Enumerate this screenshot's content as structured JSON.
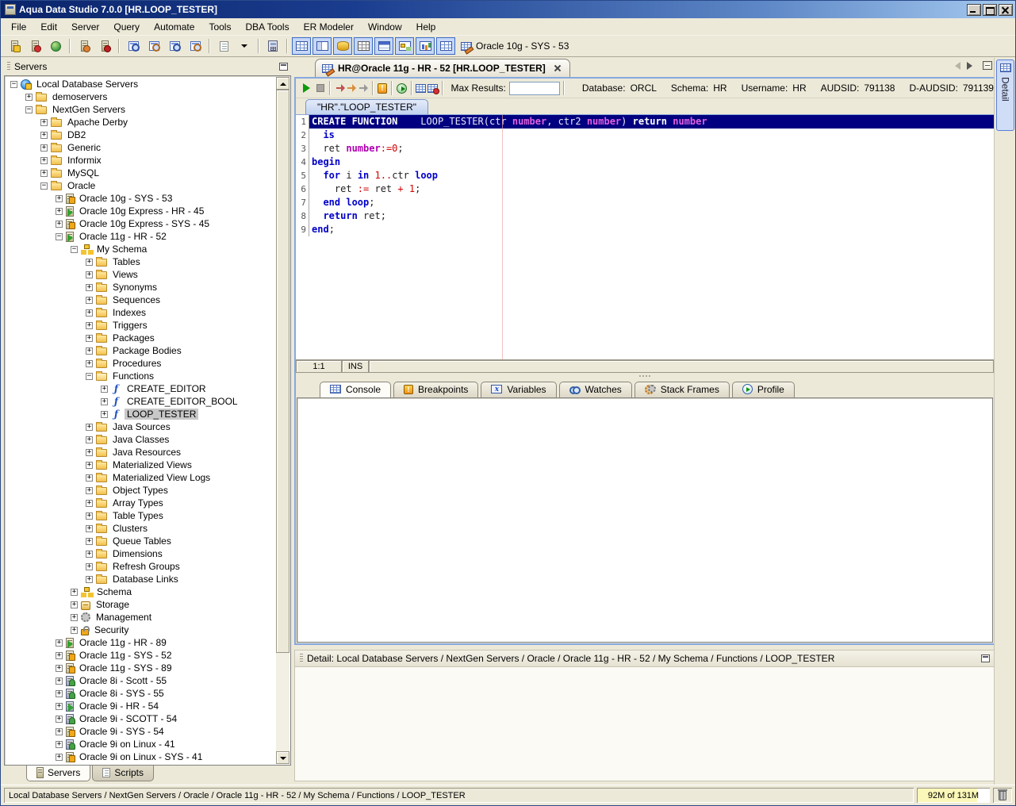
{
  "window": {
    "title": "Aqua Data Studio 7.0.0 [HR.LOOP_TESTER]",
    "controls": [
      "minimize",
      "maximize",
      "close"
    ]
  },
  "menu": {
    "items": [
      "File",
      "Edit",
      "Server",
      "Query",
      "Automate",
      "Tools",
      "DBA Tools",
      "ER Modeler",
      "Window",
      "Help"
    ]
  },
  "toolbar": {
    "buttons": [
      {
        "name": "register-server",
        "icon": "server-plus-icon",
        "cls": "mi mi-srv b-plus"
      },
      {
        "name": "unregister-server",
        "icon": "server-minus-icon",
        "cls": "mi mi-srv b-minus"
      },
      {
        "name": "connect-all",
        "icon": "globe-icon",
        "cls": "mi mi-globe"
      },
      {
        "sep": true
      },
      {
        "name": "connect-server",
        "icon": "server-connect-icon",
        "cls": "mi mi-srv b-gear"
      },
      {
        "name": "disconnect-server",
        "icon": "server-disconnect-icon",
        "cls": "mi mi-srv b-stop"
      },
      {
        "sep": true
      },
      {
        "name": "query-analyzer",
        "icon": "query-window-icon",
        "cls": "mi mi-qwin"
      },
      {
        "name": "query-analyzer-results",
        "icon": "query-window-icon",
        "cls": "mi mi-qwin alt"
      },
      {
        "name": "query-analyzer-text",
        "icon": "query-window-icon",
        "cls": "mi mi-qwin"
      },
      {
        "name": "query-builder",
        "icon": "query-builder-icon",
        "cls": "mi mi-qwin alt"
      },
      {
        "sep": true
      },
      {
        "name": "open-script",
        "icon": "script-icon",
        "cls": "mi mi-script"
      },
      {
        "name": "script-dropdown",
        "icon": "dropdown-arrow-icon",
        "cls": "mi mi-dd"
      },
      {
        "sep": true
      },
      {
        "name": "tools-window",
        "icon": "calculator-icon",
        "cls": "mi mi-calc"
      },
      {
        "sep": true
      },
      {
        "name": "view-grid",
        "icon": "view-grid-icon",
        "cls": "vi vi-grid",
        "pressed": true
      },
      {
        "name": "view-form",
        "icon": "view-form-icon",
        "cls": "vi vi-form",
        "pressed": true
      },
      {
        "name": "view-database",
        "icon": "view-database-icon",
        "cls": "vi vi-db",
        "pressed": true
      },
      {
        "name": "view-table",
        "icon": "view-table-icon",
        "cls": "vi vi-table",
        "pressed": true
      },
      {
        "name": "view-schedule",
        "icon": "view-schedule-icon",
        "cls": "vi vi-cal",
        "pressed": true
      },
      {
        "name": "view-references",
        "icon": "view-references-icon",
        "cls": "vi vi-rel",
        "pressed": true
      },
      {
        "name": "view-chart",
        "icon": "view-chart-icon",
        "cls": "vi vi-chart",
        "pressed": true
      },
      {
        "name": "view-detail",
        "icon": "view-detail-icon",
        "cls": "vi vi-grid2",
        "pressed": true
      }
    ],
    "connection_label": "Oracle 10g - SYS - 53"
  },
  "servers_panel": {
    "title": "Servers",
    "bottom_tabs": [
      {
        "label": "Servers",
        "icon": "server-icon",
        "active": true
      },
      {
        "label": "Scripts",
        "icon": "script-icon",
        "active": false
      }
    ],
    "tree": [
      {
        "label": "Local Database Servers",
        "level": 0,
        "exp": "-",
        "icon": "globe"
      },
      {
        "label": "demoservers",
        "level": 1,
        "exp": "+",
        "icon": "folder"
      },
      {
        "label": "NextGen Servers",
        "level": 1,
        "exp": "-",
        "icon": "folder"
      },
      {
        "label": "Apache Derby",
        "level": 2,
        "exp": "+",
        "icon": "folder"
      },
      {
        "label": "DB2",
        "level": 2,
        "exp": "+",
        "icon": "folder"
      },
      {
        "label": "Generic",
        "level": 2,
        "exp": "+",
        "icon": "folder"
      },
      {
        "label": "Informix",
        "level": 2,
        "exp": "+",
        "icon": "folder"
      },
      {
        "label": "MySQL",
        "level": 2,
        "exp": "+",
        "icon": "folder"
      },
      {
        "label": "Oracle",
        "level": 2,
        "exp": "-",
        "icon": "folder"
      },
      {
        "label": "Oracle 10g - SYS - 53",
        "level": 3,
        "exp": "+",
        "icon": "srv-sys"
      },
      {
        "label": "Oracle 10g Express - HR - 45",
        "level": 3,
        "exp": "+",
        "icon": "srv-hr"
      },
      {
        "label": "Oracle 10g Express - SYS - 45",
        "level": 3,
        "exp": "+",
        "icon": "srv-sys"
      },
      {
        "label": "Oracle 11g - HR - 52",
        "level": 3,
        "exp": "-",
        "icon": "srv-hr"
      },
      {
        "label": "My Schema",
        "level": 4,
        "exp": "-",
        "icon": "schema"
      },
      {
        "label": "Tables",
        "level": 5,
        "exp": "+",
        "icon": "folder"
      },
      {
        "label": "Views",
        "level": 5,
        "exp": "+",
        "icon": "folder"
      },
      {
        "label": "Synonyms",
        "level": 5,
        "exp": "+",
        "icon": "folder"
      },
      {
        "label": "Sequences",
        "level": 5,
        "exp": "+",
        "icon": "folder"
      },
      {
        "label": "Indexes",
        "level": 5,
        "exp": "+",
        "icon": "folder"
      },
      {
        "label": "Triggers",
        "level": 5,
        "exp": "+",
        "icon": "folder"
      },
      {
        "label": "Packages",
        "level": 5,
        "exp": "+",
        "icon": "folder"
      },
      {
        "label": "Package Bodies",
        "level": 5,
        "exp": "+",
        "icon": "folder"
      },
      {
        "label": "Procedures",
        "level": 5,
        "exp": "+",
        "icon": "folder"
      },
      {
        "label": "Functions",
        "level": 5,
        "exp": "-",
        "icon": "folder-open"
      },
      {
        "label": "CREATE_EDITOR",
        "level": 6,
        "exp": "+",
        "icon": "fn"
      },
      {
        "label": "CREATE_EDITOR_BOOL",
        "level": 6,
        "exp": "+",
        "icon": "fn"
      },
      {
        "label": "LOOP_TESTER",
        "level": 6,
        "exp": "+",
        "icon": "fn",
        "selected": true
      },
      {
        "label": "Java Sources",
        "level": 5,
        "exp": "+",
        "icon": "folder"
      },
      {
        "label": "Java Classes",
        "level": 5,
        "exp": "+",
        "icon": "folder"
      },
      {
        "label": "Java Resources",
        "level": 5,
        "exp": "+",
        "icon": "folder"
      },
      {
        "label": "Materialized Views",
        "level": 5,
        "exp": "+",
        "icon": "folder"
      },
      {
        "label": "Materialized View Logs",
        "level": 5,
        "exp": "+",
        "icon": "folder"
      },
      {
        "label": "Object Types",
        "level": 5,
        "exp": "+",
        "icon": "folder"
      },
      {
        "label": "Array Types",
        "level": 5,
        "exp": "+",
        "icon": "folder"
      },
      {
        "label": "Table Types",
        "level": 5,
        "exp": "+",
        "icon": "folder"
      },
      {
        "label": "Clusters",
        "level": 5,
        "exp": "+",
        "icon": "folder"
      },
      {
        "label": "Queue Tables",
        "level": 5,
        "exp": "+",
        "icon": "folder"
      },
      {
        "label": "Dimensions",
        "level": 5,
        "exp": "+",
        "icon": "folder"
      },
      {
        "label": "Refresh Groups",
        "level": 5,
        "exp": "+",
        "icon": "folder"
      },
      {
        "label": "Database Links",
        "level": 5,
        "exp": "+",
        "icon": "folder"
      },
      {
        "label": "Schema",
        "level": 4,
        "exp": "+",
        "icon": "schema"
      },
      {
        "label": "Storage",
        "level": 4,
        "exp": "+",
        "icon": "storage"
      },
      {
        "label": "Management",
        "level": 4,
        "exp": "+",
        "icon": "mgmt"
      },
      {
        "label": "Security",
        "level": 4,
        "exp": "+",
        "icon": "security"
      },
      {
        "label": "Oracle 11g - HR - 89",
        "level": 3,
        "exp": "+",
        "icon": "srv-hr"
      },
      {
        "label": "Oracle 11g - SYS - 52",
        "level": 3,
        "exp": "+",
        "icon": "srv-sys"
      },
      {
        "label": "Oracle 11g - SYS - 89",
        "level": 3,
        "exp": "+",
        "icon": "srv-sys"
      },
      {
        "label": "Oracle 8i - Scott - 55",
        "level": 3,
        "exp": "+",
        "icon": "srv-8"
      },
      {
        "label": "Oracle 8i - SYS - 55",
        "level": 3,
        "exp": "+",
        "icon": "srv-8"
      },
      {
        "label": "Oracle 9i - HR - 54",
        "level": 3,
        "exp": "+",
        "icon": "srv-8hr"
      },
      {
        "label": "Oracle 9i - SCOTT - 54",
        "level": 3,
        "exp": "+",
        "icon": "srv-8"
      },
      {
        "label": "Oracle 9i - SYS - 54",
        "level": 3,
        "exp": "+",
        "icon": "srv-sys"
      },
      {
        "label": "Oracle 9i on Linux - 41",
        "level": 3,
        "exp": "+",
        "icon": "srv-8"
      },
      {
        "label": "Oracle 9i on Linux - SYS - 41",
        "level": 3,
        "exp": "+",
        "icon": "srv-sys"
      },
      {
        "label": "",
        "level": 2,
        "exp": "",
        "icon": "folder"
      }
    ]
  },
  "editor": {
    "doc_tab": "HR@Oracle 11g - HR - 52 [HR.LOOP_TESTER]",
    "inner_tab": "\"HR\".\"LOOP_TESTER\"",
    "max_results_label": "Max Results:",
    "max_results_value": "",
    "info": [
      {
        "label": "Database:",
        "value": "ORCL"
      },
      {
        "label": "Schema:",
        "value": "HR"
      },
      {
        "label": "Username:",
        "value": "HR"
      },
      {
        "label": "AUDSID:",
        "value": "791138"
      },
      {
        "label": "D-AUDSID:",
        "value": "791139"
      }
    ],
    "qbuttons": [
      {
        "name": "execute",
        "icon": "play-icon",
        "cls": "ic-play"
      },
      {
        "name": "stop",
        "icon": "stop-icon",
        "cls": "ic-stop"
      },
      {
        "sep": true
      },
      {
        "name": "step-into",
        "icon": "step-into-icon",
        "cls": "ic-arr red"
      },
      {
        "name": "step-over",
        "icon": "step-over-icon",
        "cls": "ic-arr org"
      },
      {
        "name": "step-out",
        "icon": "step-out-icon",
        "cls": "ic-arr gry"
      },
      {
        "sep": true
      },
      {
        "name": "toggle-breakpoint",
        "icon": "breakpoint-icon",
        "cls": "ic-warn",
        "text": "!"
      },
      {
        "sep": true
      },
      {
        "name": "history",
        "icon": "history-clock-icon",
        "cls": "ic-clock"
      },
      {
        "sep": true
      },
      {
        "name": "results-grid",
        "icon": "results-grid-icon",
        "cls": "ic-gridx"
      },
      {
        "name": "results-options",
        "icon": "results-options-icon",
        "cls": "ic-gridx star"
      },
      {
        "sep": true
      }
    ],
    "status": {
      "cursor": "1:1",
      "mode": "INS"
    },
    "code": [
      {
        "num": "1",
        "sel": true,
        "toks": [
          [
            "CREATE FUNCTION",
            "skw"
          ],
          [
            "    LOOP_TESTER(ctr ",
            "spl"
          ],
          [
            "number",
            "sty"
          ],
          [
            ", ctr2 ",
            "spl"
          ],
          [
            "number",
            "sty"
          ],
          [
            ") ",
            "spl"
          ],
          [
            "return",
            "skw"
          ],
          [
            " ",
            "spl"
          ],
          [
            "number",
            "sty"
          ]
        ]
      },
      {
        "num": "2",
        "toks": [
          [
            "  ",
            "pl"
          ],
          [
            "is",
            "kw"
          ]
        ]
      },
      {
        "num": "3",
        "toks": [
          [
            "  ret ",
            "pl"
          ],
          [
            "number",
            "ty"
          ],
          [
            ":=",
            "op"
          ],
          [
            "0",
            "num"
          ],
          [
            ";",
            "pl"
          ]
        ]
      },
      {
        "num": "4",
        "toks": [
          [
            "begin",
            "kw"
          ]
        ]
      },
      {
        "num": "5",
        "toks": [
          [
            "  ",
            "pl"
          ],
          [
            "for",
            "kw"
          ],
          [
            " i ",
            "pl"
          ],
          [
            "in",
            "kw"
          ],
          [
            " ",
            "pl"
          ],
          [
            "1",
            "num"
          ],
          [
            "..",
            "op"
          ],
          [
            "ctr ",
            "pl"
          ],
          [
            "loop",
            "kw"
          ]
        ]
      },
      {
        "num": "6",
        "toks": [
          [
            "    ret ",
            "pl"
          ],
          [
            ":=",
            "op"
          ],
          [
            " ret ",
            "pl"
          ],
          [
            "+ ",
            "op"
          ],
          [
            "1",
            "num"
          ],
          [
            ";",
            "pl"
          ]
        ]
      },
      {
        "num": "7",
        "toks": [
          [
            "  ",
            "pl"
          ],
          [
            "end loop",
            "kw"
          ],
          [
            ";",
            "pl"
          ]
        ]
      },
      {
        "num": "8",
        "toks": [
          [
            "  ",
            "pl"
          ],
          [
            "return",
            "kw"
          ],
          [
            " ret;",
            "pl"
          ]
        ]
      },
      {
        "num": "9",
        "toks": [
          [
            "end",
            "kw"
          ],
          [
            ";",
            "pl"
          ]
        ]
      }
    ]
  },
  "console": {
    "tabs": [
      {
        "label": "Console",
        "icon": "console-grid-icon",
        "cls": "ct-console",
        "active": true
      },
      {
        "label": "Breakpoints",
        "icon": "breakpoints-icon",
        "cls": "ct-break",
        "text": "!"
      },
      {
        "label": "Variables",
        "icon": "variables-icon",
        "cls": "ct-var",
        "text": "x"
      },
      {
        "label": "Watches",
        "icon": "watches-icon",
        "cls": "ct-watch"
      },
      {
        "label": "Stack Frames",
        "icon": "stack-frames-icon",
        "cls": "ct-stack"
      },
      {
        "label": "Profile",
        "icon": "profile-icon",
        "cls": "ct-profile"
      }
    ]
  },
  "detail_panel": {
    "title": "Detail: Local Database Servers / NextGen Servers / Oracle / Oracle 11g - HR - 52 / My Schema / Functions / LOOP_TESTER",
    "side_tab": "Detail"
  },
  "status_bar": {
    "path": "Local Database Servers / NextGen Servers / Oracle / Oracle 11g - HR - 52 / My Schema / Functions / LOOP_TESTER",
    "memory": "92M of 131M"
  },
  "colors": {
    "title_gradient_from": "#0a246a",
    "title_gradient_to": "#a6caf0",
    "editor_selection": "#000080",
    "keyword": "#0000c8",
    "type_keyword": "#b000b0",
    "number_literal": "#d00000",
    "tree_selection": "#c8c8c8",
    "pressed_button": "#c6d7f7",
    "memory_fill": "#fbf7b8"
  }
}
